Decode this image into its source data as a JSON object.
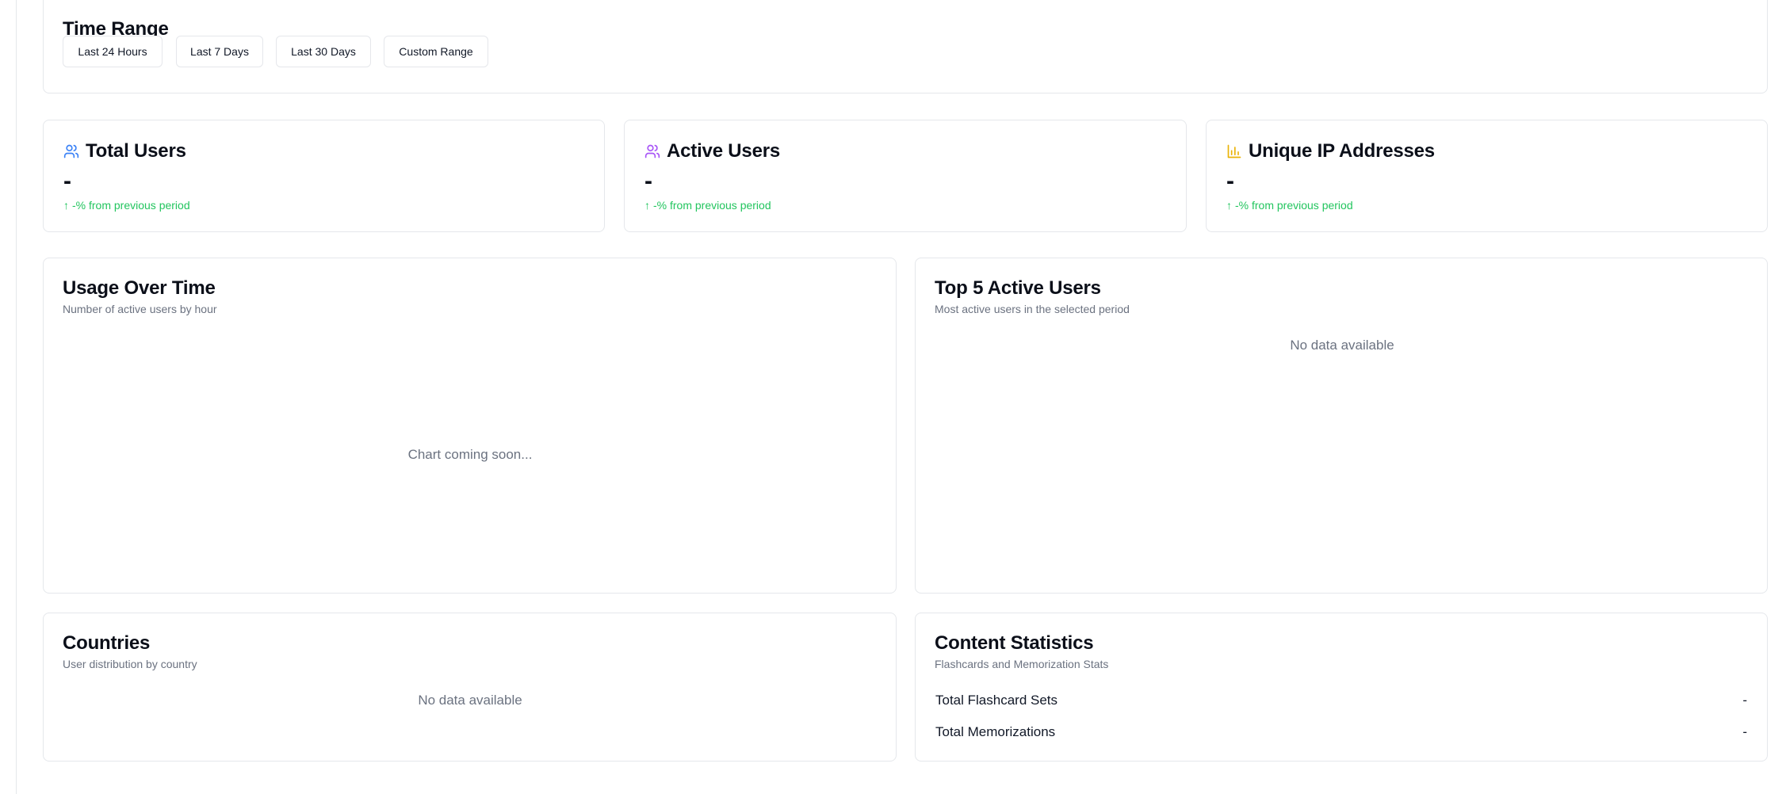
{
  "time_range": {
    "title": "Time Range",
    "buttons": [
      "Last 24 Hours",
      "Last 7 Days",
      "Last 30 Days",
      "Custom Range"
    ]
  },
  "stats": [
    {
      "title": "Total Users",
      "value": "-",
      "change": "-% from previous period",
      "icon": "users-icon",
      "icon_color": "#3b82f6"
    },
    {
      "title": "Active Users",
      "value": "-",
      "change": "-% from previous period",
      "icon": "users-icon",
      "icon_color": "#a855f7"
    },
    {
      "title": "Unique IP Addresses",
      "value": "-",
      "change": "-% from previous period",
      "icon": "bar-chart-icon",
      "icon_color": "#eab308"
    }
  ],
  "change_arrow": "↑",
  "change_color": "#22c55e",
  "usage": {
    "title": "Usage Over Time",
    "subtitle": "Number of active users by hour",
    "placeholder": "Chart coming soon..."
  },
  "top_users": {
    "title": "Top 5 Active Users",
    "subtitle": "Most active users in the selected period",
    "empty": "No data available"
  },
  "countries": {
    "title": "Countries",
    "subtitle": "User distribution by country",
    "empty": "No data available"
  },
  "content_stats": {
    "title": "Content Statistics",
    "subtitle": "Flashcards and Memorization Stats",
    "rows": [
      {
        "label": "Total Flashcard Sets",
        "value": "-"
      },
      {
        "label": "Total Memorizations",
        "value": "-"
      }
    ]
  }
}
